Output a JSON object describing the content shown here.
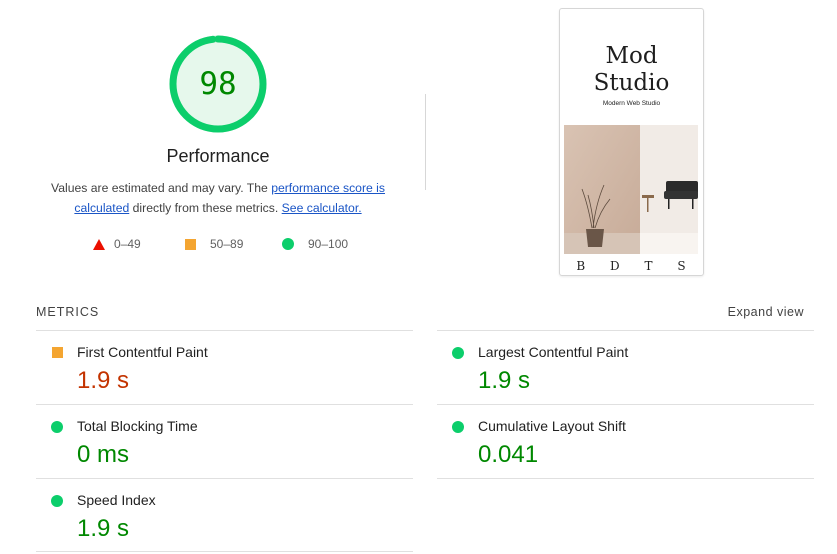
{
  "score": {
    "value": "98",
    "fraction": 0.98,
    "color": "#0cce6b"
  },
  "category_title": "Performance",
  "description": {
    "part1": "Values are estimated and may vary. The ",
    "link1": "performance score is calculated",
    "part2": " directly from these metrics. ",
    "link2": "See calculator."
  },
  "legend": [
    {
      "shape": "triangle",
      "label": "0–49",
      "color": "#eb0f00"
    },
    {
      "shape": "square",
      "label": "50–89",
      "color": "#f4a531"
    },
    {
      "shape": "circle",
      "label": "90–100",
      "color": "#0cce6b"
    }
  ],
  "screenshot": {
    "brand_line1": "Mod",
    "brand_line2": "Studio",
    "tagline": "Modern Web Studio",
    "nav": [
      "B",
      "D",
      "T",
      "S"
    ]
  },
  "metrics": {
    "header": "METRICS",
    "expand_label": "Expand view",
    "items": [
      {
        "name": "First Contentful Paint",
        "value": "1.9 s",
        "status": "average"
      },
      {
        "name": "Largest Contentful Paint",
        "value": "1.9 s",
        "status": "pass"
      },
      {
        "name": "Total Blocking Time",
        "value": "0 ms",
        "status": "pass"
      },
      {
        "name": "Cumulative Layout Shift",
        "value": "0.041",
        "status": "pass"
      },
      {
        "name": "Speed Index",
        "value": "1.9 s",
        "status": "pass"
      }
    ]
  }
}
